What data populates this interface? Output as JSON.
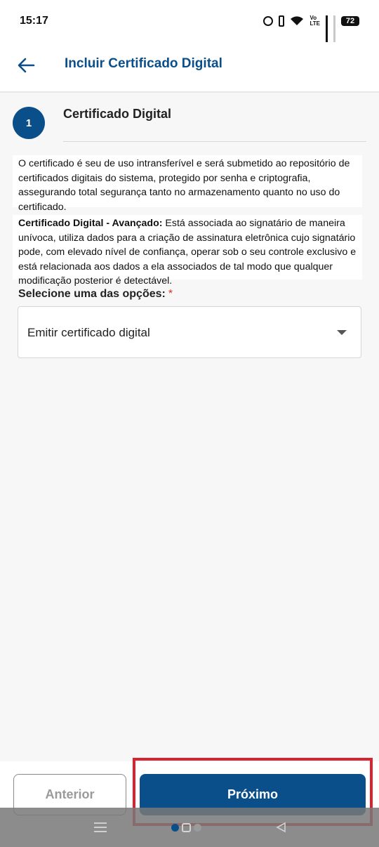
{
  "status_bar": {
    "time": "15:17",
    "battery": "72",
    "volte_label": "Vo\nLTE",
    "icons": [
      "alarm-icon",
      "vibrate-icon",
      "wifi-icon",
      "volte-icon",
      "signal-icon",
      "signal-no-service-icon",
      "battery-icon"
    ]
  },
  "header": {
    "back_icon": "arrow-left-icon",
    "title": "Incluir Certificado Digital"
  },
  "step": {
    "number": "1",
    "title": "Certificado Digital"
  },
  "content": {
    "paragraph_1": "O certificado é seu de uso intransferível e será submetido ao repositório de certificados digitais do sistema, protegido por senha e criptografia, assegurando total segurança tanto no armazenamento quanto no uso do certificado.",
    "paragraph_2_bold": "Certificado Digital - Avançado:",
    "paragraph_2_text": " Está associada ao signatário de maneira unívoca, utiliza dados para a criação de assinatura eletrônica cujo signatário pode, com elevado nível de confiança, operar sob o seu controle exclusivo e está relacionada aos dados a ela associados de tal modo que qualquer modificação posterior é detectável."
  },
  "select": {
    "label": "Selecione uma das opções:",
    "required_mark": "*",
    "value": "Emitir certificado digital"
  },
  "footer": {
    "prev_label": "Anterior",
    "next_label": "Próximo"
  },
  "colors": {
    "primary": "#0b4f8a",
    "highlight": "#d9232e",
    "required": "#d9342b"
  }
}
